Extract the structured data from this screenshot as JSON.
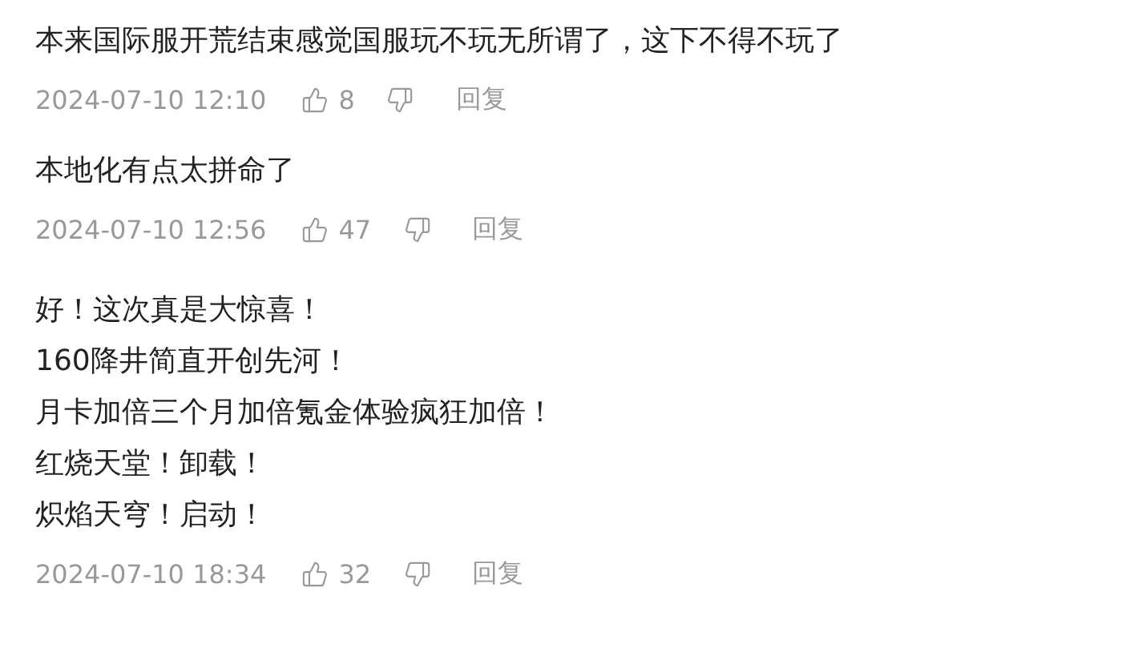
{
  "comments": [
    {
      "lines": [
        "本来国际服开荒结束感觉国服玩不玩无所谓了，这下不得不玩了"
      ],
      "time": "2024-07-10 12:10",
      "likes": "8",
      "reply": "回复"
    },
    {
      "lines": [
        "本地化有点太拼命了"
      ],
      "time": "2024-07-10 12:56",
      "likes": "47",
      "reply": "回复"
    },
    {
      "lines": [
        "好！这次真是大惊喜！",
        "160降井简直开创先河！",
        "月卡加倍三个月加倍氪金体验疯狂加倍！",
        "红烧天堂！卸载！",
        "炽焰天穹！启动！"
      ],
      "time": "2024-07-10 18:34",
      "likes": "32",
      "reply": "回复"
    }
  ]
}
